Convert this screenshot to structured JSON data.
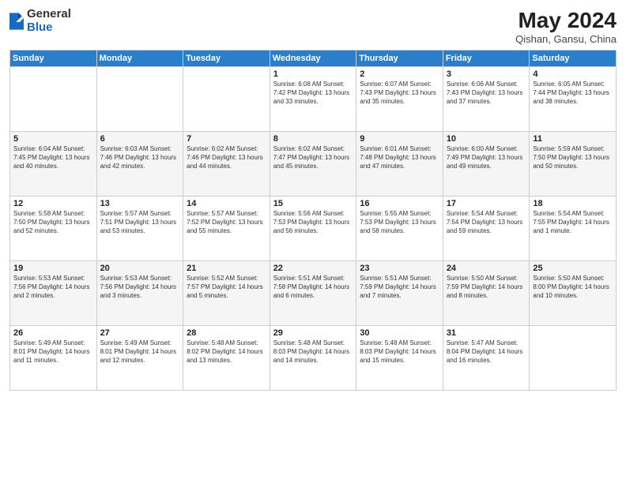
{
  "header": {
    "logo": {
      "general": "General",
      "blue": "Blue"
    },
    "title": "May 2024",
    "location": "Qishan, Gansu, China"
  },
  "weekdays": [
    "Sunday",
    "Monday",
    "Tuesday",
    "Wednesday",
    "Thursday",
    "Friday",
    "Saturday"
  ],
  "weeks": [
    [
      {
        "day": "",
        "info": ""
      },
      {
        "day": "",
        "info": ""
      },
      {
        "day": "",
        "info": ""
      },
      {
        "day": "1",
        "info": "Sunrise: 6:08 AM\nSunset: 7:42 PM\nDaylight: 13 hours\nand 33 minutes."
      },
      {
        "day": "2",
        "info": "Sunrise: 6:07 AM\nSunset: 7:43 PM\nDaylight: 13 hours\nand 35 minutes."
      },
      {
        "day": "3",
        "info": "Sunrise: 6:06 AM\nSunset: 7:43 PM\nDaylight: 13 hours\nand 37 minutes."
      },
      {
        "day": "4",
        "info": "Sunrise: 6:05 AM\nSunset: 7:44 PM\nDaylight: 13 hours\nand 38 minutes."
      }
    ],
    [
      {
        "day": "5",
        "info": "Sunrise: 6:04 AM\nSunset: 7:45 PM\nDaylight: 13 hours\nand 40 minutes."
      },
      {
        "day": "6",
        "info": "Sunrise: 6:03 AM\nSunset: 7:46 PM\nDaylight: 13 hours\nand 42 minutes."
      },
      {
        "day": "7",
        "info": "Sunrise: 6:02 AM\nSunset: 7:46 PM\nDaylight: 13 hours\nand 44 minutes."
      },
      {
        "day": "8",
        "info": "Sunrise: 6:02 AM\nSunset: 7:47 PM\nDaylight: 13 hours\nand 45 minutes."
      },
      {
        "day": "9",
        "info": "Sunrise: 6:01 AM\nSunset: 7:48 PM\nDaylight: 13 hours\nand 47 minutes."
      },
      {
        "day": "10",
        "info": "Sunrise: 6:00 AM\nSunset: 7:49 PM\nDaylight: 13 hours\nand 49 minutes."
      },
      {
        "day": "11",
        "info": "Sunrise: 5:59 AM\nSunset: 7:50 PM\nDaylight: 13 hours\nand 50 minutes."
      }
    ],
    [
      {
        "day": "12",
        "info": "Sunrise: 5:58 AM\nSunset: 7:50 PM\nDaylight: 13 hours\nand 52 minutes."
      },
      {
        "day": "13",
        "info": "Sunrise: 5:57 AM\nSunset: 7:51 PM\nDaylight: 13 hours\nand 53 minutes."
      },
      {
        "day": "14",
        "info": "Sunrise: 5:57 AM\nSunset: 7:52 PM\nDaylight: 13 hours\nand 55 minutes."
      },
      {
        "day": "15",
        "info": "Sunrise: 5:56 AM\nSunset: 7:53 PM\nDaylight: 13 hours\nand 56 minutes."
      },
      {
        "day": "16",
        "info": "Sunrise: 5:55 AM\nSunset: 7:53 PM\nDaylight: 13 hours\nand 58 minutes."
      },
      {
        "day": "17",
        "info": "Sunrise: 5:54 AM\nSunset: 7:54 PM\nDaylight: 13 hours\nand 59 minutes."
      },
      {
        "day": "18",
        "info": "Sunrise: 5:54 AM\nSunset: 7:55 PM\nDaylight: 14 hours\nand 1 minute."
      }
    ],
    [
      {
        "day": "19",
        "info": "Sunrise: 5:53 AM\nSunset: 7:56 PM\nDaylight: 14 hours\nand 2 minutes."
      },
      {
        "day": "20",
        "info": "Sunrise: 5:53 AM\nSunset: 7:56 PM\nDaylight: 14 hours\nand 3 minutes."
      },
      {
        "day": "21",
        "info": "Sunrise: 5:52 AM\nSunset: 7:57 PM\nDaylight: 14 hours\nand 5 minutes."
      },
      {
        "day": "22",
        "info": "Sunrise: 5:51 AM\nSunset: 7:58 PM\nDaylight: 14 hours\nand 6 minutes."
      },
      {
        "day": "23",
        "info": "Sunrise: 5:51 AM\nSunset: 7:59 PM\nDaylight: 14 hours\nand 7 minutes."
      },
      {
        "day": "24",
        "info": "Sunrise: 5:50 AM\nSunset: 7:59 PM\nDaylight: 14 hours\nand 8 minutes."
      },
      {
        "day": "25",
        "info": "Sunrise: 5:50 AM\nSunset: 8:00 PM\nDaylight: 14 hours\nand 10 minutes."
      }
    ],
    [
      {
        "day": "26",
        "info": "Sunrise: 5:49 AM\nSunset: 8:01 PM\nDaylight: 14 hours\nand 11 minutes."
      },
      {
        "day": "27",
        "info": "Sunrise: 5:49 AM\nSunset: 8:01 PM\nDaylight: 14 hours\nand 12 minutes."
      },
      {
        "day": "28",
        "info": "Sunrise: 5:48 AM\nSunset: 8:02 PM\nDaylight: 14 hours\nand 13 minutes."
      },
      {
        "day": "29",
        "info": "Sunrise: 5:48 AM\nSunset: 8:03 PM\nDaylight: 14 hours\nand 14 minutes."
      },
      {
        "day": "30",
        "info": "Sunrise: 5:48 AM\nSunset: 8:03 PM\nDaylight: 14 hours\nand 15 minutes."
      },
      {
        "day": "31",
        "info": "Sunrise: 5:47 AM\nSunset: 8:04 PM\nDaylight: 14 hours\nand 16 minutes."
      },
      {
        "day": "",
        "info": ""
      }
    ]
  ]
}
